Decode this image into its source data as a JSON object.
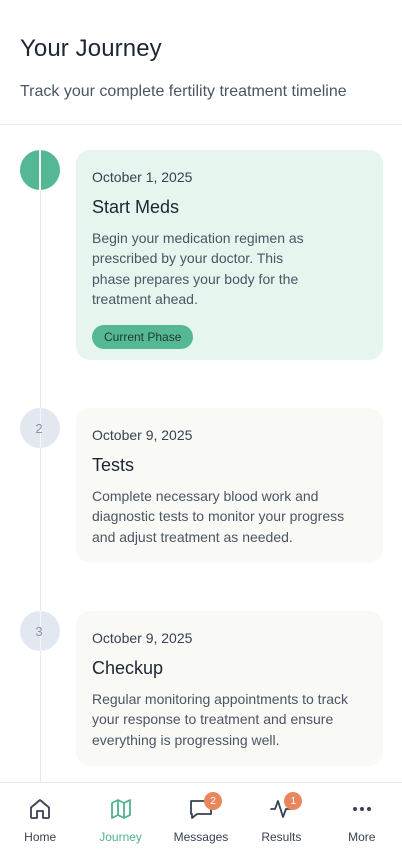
{
  "header": {
    "title": "Your Journey",
    "subtitle": "Track your complete fertility treatment timeline"
  },
  "timeline": {
    "steps": [
      {
        "number": "1",
        "date": "October 1, 2025",
        "title": "Start Meds",
        "description": "Begin your medication regimen as prescribed by your doctor. This phase prepares your body for the treatment ahead.",
        "badge": "Current Phase",
        "status": "current"
      },
      {
        "number": "2",
        "date": "October 9, 2025",
        "title": "Tests",
        "description": "Complete necessary blood work and diagnostic tests to monitor your progress and adjust treatment as needed.",
        "status": "upcoming"
      },
      {
        "number": "3",
        "date": "October 9, 2025",
        "title": "Checkup",
        "description": "Regular monitoring appointments to track your response to treatment and ensure everything is progressing well.",
        "status": "upcoming"
      }
    ]
  },
  "bottom_nav": {
    "items": [
      {
        "label": "Home",
        "icon": "home-icon"
      },
      {
        "label": "Journey",
        "icon": "map-icon",
        "active": true
      },
      {
        "label": "Messages",
        "icon": "chat-icon",
        "badge": "2"
      },
      {
        "label": "Results",
        "icon": "activity-icon",
        "badge": "1"
      },
      {
        "label": "More",
        "icon": "more-dots-icon"
      }
    ]
  },
  "colors": {
    "accent": "#55b894",
    "active_card": "#e6f5ee",
    "inactive_card": "#f9f9f6",
    "badge": "#e8865c"
  }
}
